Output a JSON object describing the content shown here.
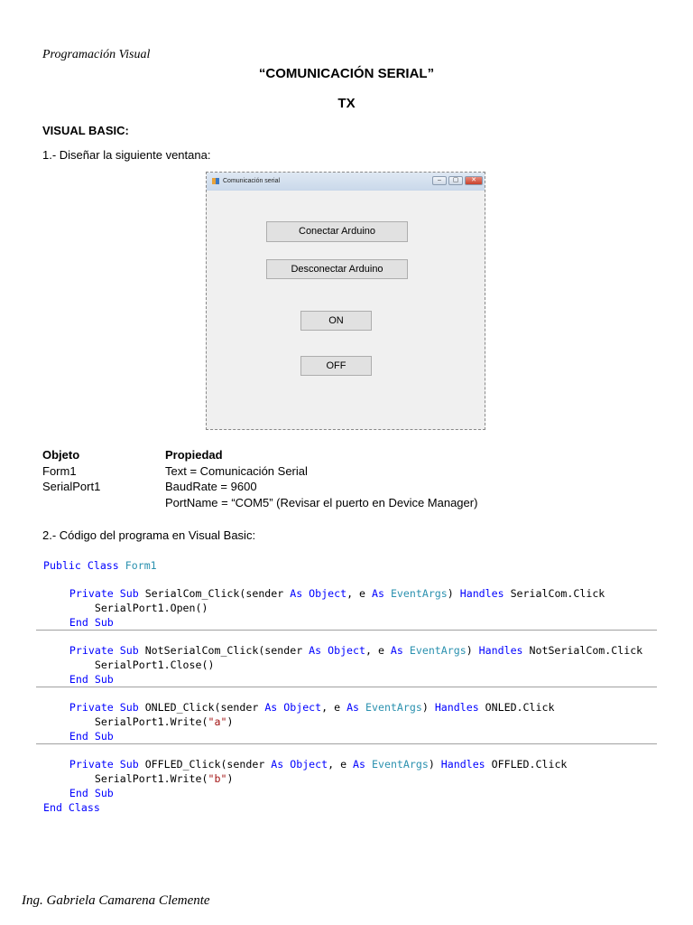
{
  "header": "Programación Visual",
  "title": "“COMUNICACIÓN SERIAL”",
  "subtitle": "TX",
  "section": "VISUAL BASIC:",
  "step1": "1.- Diseñar la siguiente ventana:",
  "window": {
    "title": "Comunicación serial",
    "buttons": [
      "Conectar Arduino",
      "Desconectar Arduino",
      "ON",
      "OFF"
    ],
    "controls": {
      "min": "–",
      "max": "▢",
      "close": "✕"
    }
  },
  "table": {
    "headers": [
      "Objeto",
      "Propiedad"
    ],
    "rows": [
      [
        "Form1",
        "Text = Comunicación Serial"
      ],
      [
        "SerialPort1",
        "BaudRate = 9600"
      ],
      [
        "",
        "PortName = “COM5” (Revisar el puerto en Device Manager)"
      ]
    ]
  },
  "step2": "2.- Código del programa en Visual Basic:",
  "code": [
    [
      [
        "kw",
        "Public Class "
      ],
      [
        "ty",
        "Form1"
      ]
    ],
    [],
    [
      [
        "kw",
        "    Private Sub "
      ],
      [
        "",
        "SerialCom_Click(sender "
      ],
      [
        "kw",
        "As Object"
      ],
      [
        "",
        ", e "
      ],
      [
        "kw",
        "As "
      ],
      [
        "ty",
        "EventArgs"
      ],
      [
        "",
        ") "
      ],
      [
        "kw",
        "Handles "
      ],
      [
        "",
        "SerialCom.Click"
      ]
    ],
    [
      [
        "",
        "        SerialPort1.Open()"
      ]
    ],
    [
      [
        "kw",
        "    End Sub"
      ]
    ],
    [],
    [
      [
        "kw",
        "    Private Sub "
      ],
      [
        "",
        "NotSerialCom_Click(sender "
      ],
      [
        "kw",
        "As Object"
      ],
      [
        "",
        ", e "
      ],
      [
        "kw",
        "As "
      ],
      [
        "ty",
        "EventArgs"
      ],
      [
        "",
        ") "
      ],
      [
        "kw",
        "Handles "
      ],
      [
        "",
        "NotSerialCom.Click"
      ]
    ],
    [
      [
        "",
        "        SerialPort1.Close()"
      ]
    ],
    [
      [
        "kw",
        "    End Sub"
      ]
    ],
    [],
    [
      [
        "kw",
        "    Private Sub "
      ],
      [
        "",
        "ONLED_Click(sender "
      ],
      [
        "kw",
        "As Object"
      ],
      [
        "",
        ", e "
      ],
      [
        "kw",
        "As "
      ],
      [
        "ty",
        "EventArgs"
      ],
      [
        "",
        ") "
      ],
      [
        "kw",
        "Handles "
      ],
      [
        "",
        "ONLED.Click"
      ]
    ],
    [
      [
        "",
        "        SerialPort1.Write("
      ],
      [
        "st",
        "\"a\""
      ],
      [
        "",
        ")"
      ]
    ],
    [
      [
        "kw",
        "    End Sub"
      ]
    ],
    [],
    [
      [
        "kw",
        "    Private Sub "
      ],
      [
        "",
        "OFFLED_Click(sender "
      ],
      [
        "kw",
        "As Object"
      ],
      [
        "",
        ", e "
      ],
      [
        "kw",
        "As "
      ],
      [
        "ty",
        "EventArgs"
      ],
      [
        "",
        ") "
      ],
      [
        "kw",
        "Handles "
      ],
      [
        "",
        "OFFLED.Click"
      ]
    ],
    [
      [
        "",
        "        SerialPort1.Write("
      ],
      [
        "st",
        "\"b\""
      ],
      [
        "",
        ")"
      ]
    ],
    [
      [
        "kw",
        "    End Sub"
      ]
    ],
    [
      [
        "kw",
        "End Class"
      ]
    ]
  ],
  "footer": "Ing. Gabriela Camarena Clemente"
}
